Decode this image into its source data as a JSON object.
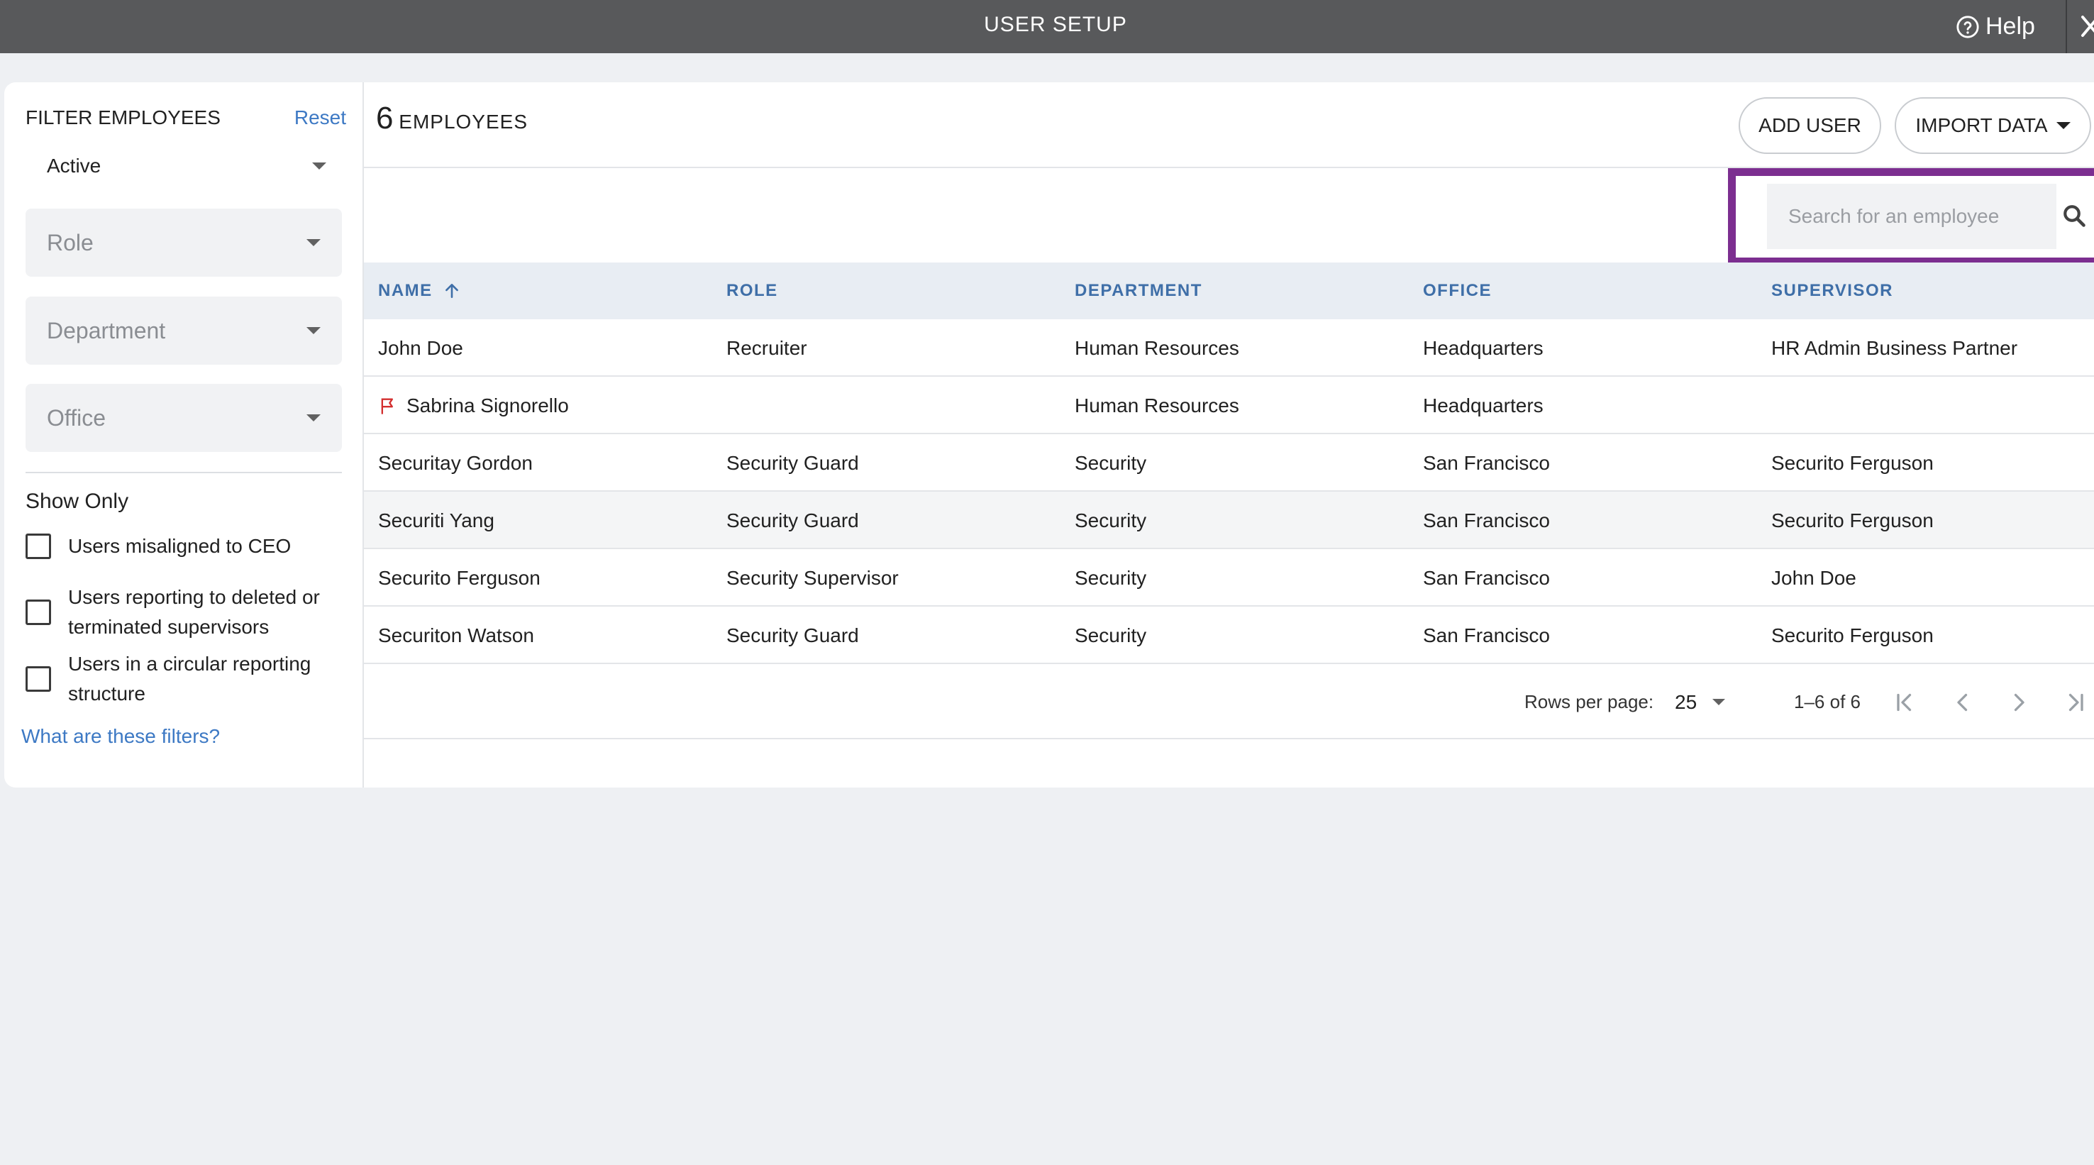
{
  "header": {
    "title": "USER SETUP",
    "help_label": "Help"
  },
  "sidebar": {
    "filter_title": "FILTER EMPLOYEES",
    "reset_label": "Reset",
    "status_value": "Active",
    "role_placeholder": "Role",
    "department_placeholder": "Department",
    "office_placeholder": "Office",
    "show_only_label": "Show Only",
    "checkboxes": [
      {
        "label": "Users misaligned to CEO",
        "checked": false
      },
      {
        "label": "Users reporting to deleted or terminated supervisors",
        "checked": false
      },
      {
        "label": "Users in a circular reporting structure",
        "checked": false
      }
    ],
    "help_link": "What are these filters?"
  },
  "main": {
    "employee_count": "6",
    "employee_count_label": "EMPLOYEES",
    "add_user_label": "ADD USER",
    "import_data_label": "IMPORT DATA",
    "search_placeholder": "Search for an employee",
    "columns": [
      "NAME",
      "ROLE",
      "DEPARTMENT",
      "OFFICE",
      "SUPERVISOR"
    ],
    "sort_column": "NAME",
    "rows": [
      {
        "name": "John Doe",
        "role": "Recruiter",
        "department": "Human Resources",
        "office": "Headquarters",
        "supervisor": "HR Admin Business Partner",
        "flagged": false
      },
      {
        "name": "Sabrina Signorello",
        "role": "",
        "department": "Human Resources",
        "office": "Headquarters",
        "supervisor": "",
        "flagged": true
      },
      {
        "name": "Securitay Gordon",
        "role": "Security Guard",
        "department": "Security",
        "office": "San Francisco",
        "supervisor": "Securito Ferguson",
        "flagged": false
      },
      {
        "name": "Securiti Yang",
        "role": "Security Guard",
        "department": "Security",
        "office": "San Francisco",
        "supervisor": "Securito Ferguson",
        "flagged": false
      },
      {
        "name": "Securito Ferguson",
        "role": "Security Supervisor",
        "department": "Security",
        "office": "San Francisco",
        "supervisor": "John Doe",
        "flagged": false
      },
      {
        "name": "Securiton Watson",
        "role": "Security Guard",
        "department": "Security",
        "office": "San Francisco",
        "supervisor": "Securito Ferguson",
        "flagged": false
      }
    ],
    "pagination": {
      "rows_per_page_label": "Rows per page:",
      "rows_per_page": "25",
      "range": "1–6 of 6"
    }
  },
  "colors": {
    "topbar": "#58595b",
    "link": "#3d79c4",
    "header_text": "#3f6fa8",
    "highlight": "#7c2e90",
    "flag": "#d32f2f"
  }
}
